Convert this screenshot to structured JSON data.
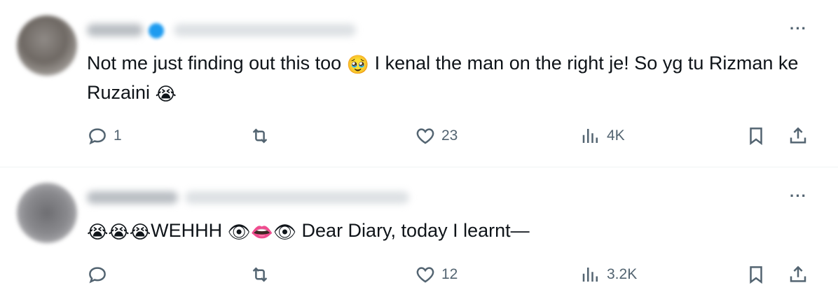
{
  "tweets": [
    {
      "text_parts": [
        "Not me just finding out this too ",
        "🥹",
        " I kenal the man on the right je! So yg tu Rizman ke Ruzaini ",
        "😭"
      ],
      "more_label": "···",
      "replies": "1",
      "retweets": "",
      "likes": "23",
      "views": "4K"
    },
    {
      "text_parts": [
        "😭😭😭",
        "WEHHH ",
        "👁👄👁",
        " Dear Diary, today I learnt—"
      ],
      "more_label": "···",
      "replies": "",
      "retweets": "",
      "likes": "12",
      "views": "3.2K"
    }
  ],
  "icons": {
    "reply": "reply-icon",
    "retweet": "retweet-icon",
    "like": "heart-icon",
    "views": "views-icon",
    "bookmark": "bookmark-icon",
    "share": "share-icon"
  },
  "colors": {
    "muted": "#536471",
    "text": "#0f1419",
    "verified": "#1d9bf0",
    "divider": "#eff3f4"
  }
}
